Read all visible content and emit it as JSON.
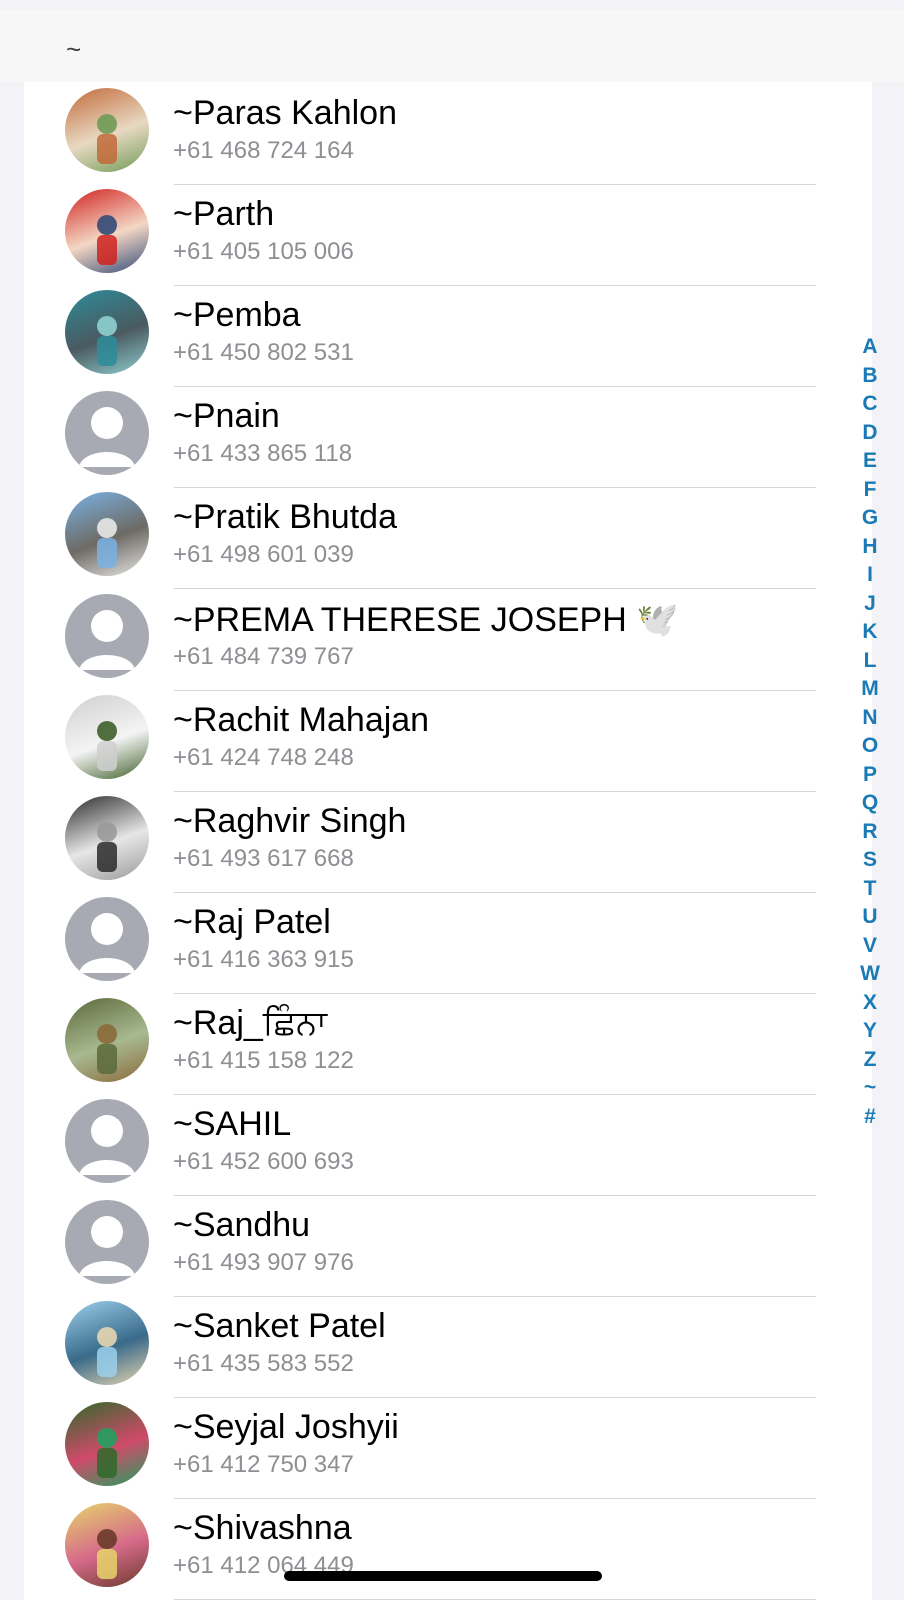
{
  "section_header": {
    "title": "~"
  },
  "contacts": [
    {
      "name": "~Paras Kahlon",
      "phone": "+61 468 724 164",
      "avatar": "photo",
      "colors": [
        "#c26a3a",
        "#6f9a55",
        "#e8d9c2"
      ]
    },
    {
      "name": "~Parth",
      "phone": "+61 405 105 006",
      "avatar": "photo",
      "colors": [
        "#d0221f",
        "#334a78",
        "#f4d7c4"
      ]
    },
    {
      "name": "~Pemba",
      "phone": "+61 450 802 531",
      "avatar": "photo",
      "colors": [
        "#2d8c9a",
        "#8fd0d0",
        "#4a5a60"
      ]
    },
    {
      "name": "~Pnain",
      "phone": "+61 433 865 118",
      "avatar": "placeholder"
    },
    {
      "name": "~Pratik Bhutda",
      "phone": "+61 498 601 039",
      "avatar": "photo",
      "colors": [
        "#7ab2e4",
        "#e8e8e6",
        "#6d6a64"
      ]
    },
    {
      "name": "~PREMA THERESE JOSEPH 🕊️",
      "phone": "+61 484 739 767",
      "avatar": "placeholder"
    },
    {
      "name": "~Rachit Mahajan",
      "phone": "+61 424 748 248",
      "avatar": "photo",
      "colors": [
        "#cfcfcf",
        "#3f5f2a",
        "#f4f4f4"
      ]
    },
    {
      "name": "~Raghvir Singh",
      "phone": "+61 493 617 668",
      "avatar": "photo",
      "colors": [
        "#2a2a2a",
        "#9a9a9a",
        "#e6e6e6"
      ]
    },
    {
      "name": "~Raj Patel",
      "phone": "+61 416 363 915",
      "avatar": "placeholder"
    },
    {
      "name": "~Raj_ਛਿੰਨਾ",
      "phone": "+61 415 158 122",
      "avatar": "photo",
      "colors": [
        "#5b6a3a",
        "#8a6a3a",
        "#a8b890"
      ]
    },
    {
      "name": "~SAHIL",
      "phone": "+61 452 600 693",
      "avatar": "placeholder"
    },
    {
      "name": "~Sandhu",
      "phone": "+61 493 907 976",
      "avatar": "placeholder"
    },
    {
      "name": "~Sanket Patel",
      "phone": "+61 435 583 552",
      "avatar": "photo",
      "colors": [
        "#9cd0ec",
        "#e6d6b0",
        "#3a6a8a"
      ]
    },
    {
      "name": "~Seyjal Joshyii",
      "phone": "+61 412 750 347",
      "avatar": "photo",
      "colors": [
        "#2e6a2a",
        "#22a060",
        "#d04a6a"
      ]
    },
    {
      "name": "~Shivashna",
      "phone": "+61 412 064 449",
      "avatar": "photo",
      "colors": [
        "#e6d46a",
        "#6a3a2a",
        "#d66a8a"
      ]
    }
  ],
  "index_letters": [
    "A",
    "B",
    "C",
    "D",
    "E",
    "F",
    "G",
    "H",
    "I",
    "J",
    "K",
    "L",
    "M",
    "N",
    "O",
    "P",
    "Q",
    "R",
    "S",
    "T",
    "U",
    "V",
    "W",
    "X",
    "Y",
    "Z",
    "~",
    "#"
  ],
  "colors": {
    "index": "#1a7ab5",
    "placeholder_avatar": "#a7aab3",
    "secondary_text": "#8e8e93"
  }
}
